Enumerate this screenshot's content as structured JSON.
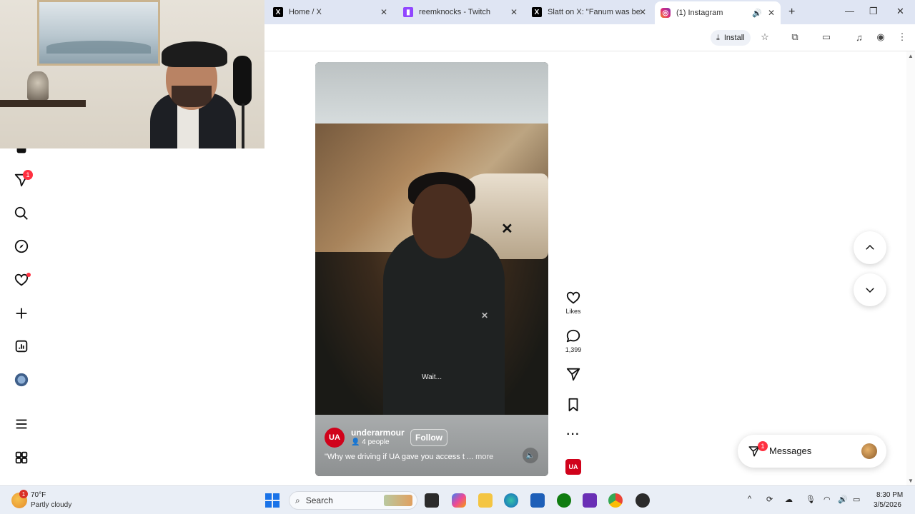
{
  "browser": {
    "tabs": [
      {
        "label": "Home / X",
        "favicon": "x-icon"
      },
      {
        "label": "reemknocks - Twitch",
        "favicon": "twitch-icon"
      },
      {
        "label": "Slatt on X: \"Fanum was be",
        "favicon": "x-icon"
      },
      {
        "label": "(1) Instagram",
        "favicon": "instagram-icon",
        "active": true
      }
    ],
    "install_label": "Install"
  },
  "sidebar": {
    "notifications_badge": "1",
    "items": [
      "home-icon",
      "direct-icon",
      "search-icon",
      "explore-icon",
      "heart-icon",
      "create-icon",
      "dashboard-icon",
      "profile-icon",
      "menu-icon",
      "threads-icon"
    ]
  },
  "reel": {
    "caption_overlay": "Wait...",
    "account_name": "underarmour",
    "shared_with": "4 people",
    "follow_label": "Follow",
    "description": "\"Why we driving if UA gave you access t ...",
    "more_label": "more",
    "actions": {
      "likes_label": "Likes",
      "comments_count": "1,399"
    }
  },
  "messages": {
    "label": "Messages",
    "badge": "1"
  },
  "taskbar": {
    "weather_temp": "70°F",
    "weather_desc": "Partly cloudy",
    "weather_badge": "1",
    "search_placeholder": "Search",
    "time": "8:30 PM",
    "date": "3/5/2026"
  },
  "colors": {
    "accent_red": "#ff3040",
    "brand_ua_red": "#d0021b",
    "tab_strip": "#dfe5f3",
    "taskbar": "#e9eef6"
  }
}
